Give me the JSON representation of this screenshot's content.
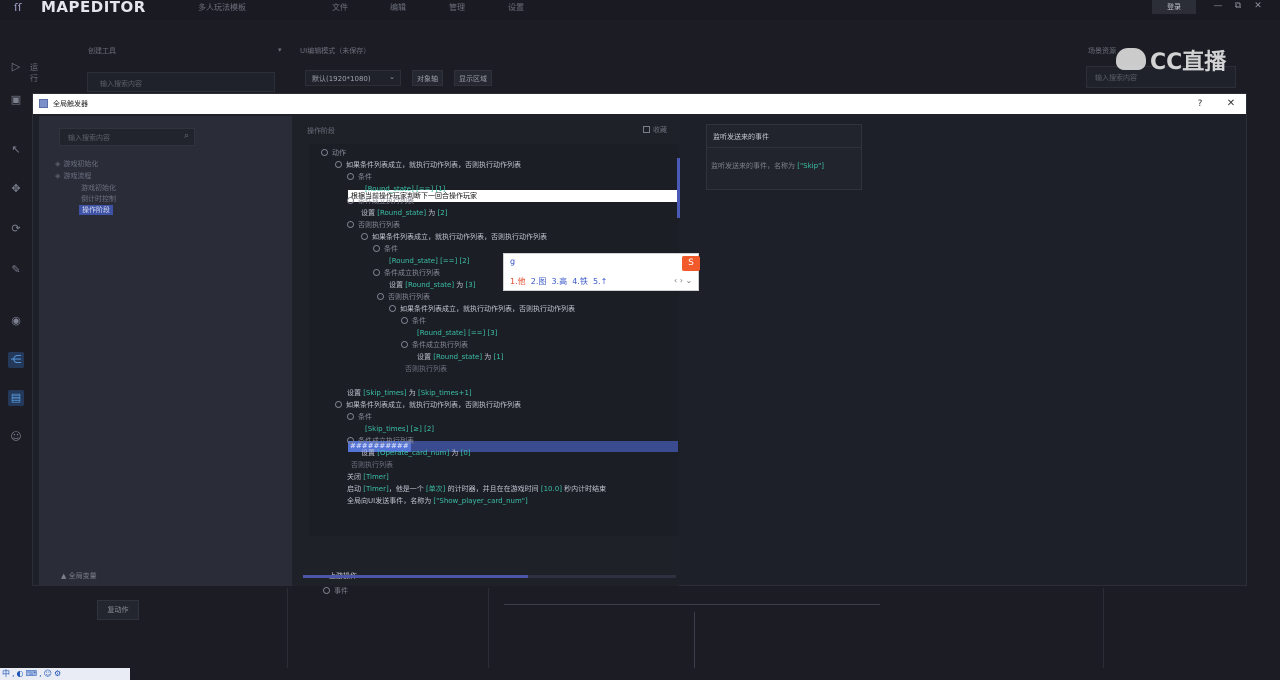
{
  "app": {
    "logo": "ſſ",
    "title": "MAPEDITOR",
    "subtitle": "多人玩法模板",
    "menu": [
      "文件",
      "编辑",
      "管理",
      "设置"
    ],
    "login_label": "登录",
    "win_controls": [
      "—",
      "⧉",
      "✕"
    ]
  },
  "left_tools": {
    "run_label": "运行",
    "icons": [
      "play-icon",
      "save-icon",
      "pointer-icon",
      "move-icon",
      "rotate-icon",
      "edit-icon",
      "layer-icon",
      "share-icon",
      "ui-icon",
      "robot-icon"
    ]
  },
  "background": {
    "create_tools_title": "创建工具",
    "create_search_placeholder": "输入搜索内容",
    "ui_mode_title": "UI编辑模式（未保存）",
    "resolution": "默认(1920*1080)",
    "btn_object_axis": "对象轴",
    "btn_show_area": "显示区域",
    "right_panel_title": "场景资源",
    "right_search_placeholder": "输入搜索内容",
    "watermark": "CC直播",
    "bottom_button": "复动作",
    "taskbar": "中,◐⌨,☺⚙"
  },
  "dialog": {
    "title": "全局触发器",
    "help": "?",
    "close": "✕",
    "left": {
      "search_placeholder": "输入搜索内容",
      "tree": [
        {
          "label": "游戏初始化",
          "selected": false
        },
        {
          "label": "游戏流程",
          "selected": false
        },
        {
          "label": "游戏初始化",
          "selected": false
        },
        {
          "label": "倒计时控制",
          "selected": false
        },
        {
          "label": "操作阶段",
          "selected": true
        }
      ],
      "global_vars": "全局变量"
    },
    "middle": {
      "title": "操作阶段",
      "collect_label": "收藏",
      "editing_line": "根据当前操作玩家判断下一回合操作玩家",
      "selected_text": "##########",
      "lines": [
        {
          "text": "动作",
          "kind": "node"
        },
        {
          "text": "如果条件列表成立，就执行动作列表，否则执行动作列表",
          "kind": "plain"
        },
        {
          "text": "条件",
          "kind": "node"
        },
        {
          "text": "[Round_state] [==] [1]",
          "kind": "token"
        },
        {
          "text": "条件成立执行列表",
          "kind": "node"
        },
        {
          "pre": "设置 ",
          "tk": "[Round_state]",
          "post": " 为 ",
          "tk2": "[2]",
          "kind": "mixed"
        },
        {
          "text": "否则执行列表",
          "kind": "node"
        },
        {
          "text": "如果条件列表成立，就执行动作列表，否则执行动作列表",
          "kind": "plain"
        },
        {
          "text": "条件",
          "kind": "node"
        },
        {
          "text": "[Round_state] [==] [2]",
          "kind": "token"
        },
        {
          "text": "条件成立执行列表",
          "kind": "node"
        },
        {
          "pre": "设置 ",
          "tk": "[Round_state]",
          "post": " 为 ",
          "tk2": "[3]",
          "kind": "mixed"
        },
        {
          "text": "否则执行列表",
          "kind": "node"
        },
        {
          "text": "如果条件列表成立，就执行动作列表，否则执行动作列表",
          "kind": "plain"
        },
        {
          "text": "条件",
          "kind": "node"
        },
        {
          "text": "[Round_state] [==] [3]",
          "kind": "token"
        },
        {
          "text": "条件成立执行列表",
          "kind": "node"
        },
        {
          "pre": "设置 ",
          "tk": "[Round_state]",
          "post": " 为 ",
          "tk2": "[1]",
          "kind": "mixed"
        },
        {
          "text": "否则执行列表",
          "kind": "dim"
        },
        {
          "pre": "设置 ",
          "tk": "[Skip_times]",
          "post": " 为 ",
          "tk2": "[Skip_times+1]",
          "kind": "mixed"
        },
        {
          "text": "如果条件列表成立，就执行动作列表，否则执行动作列表",
          "kind": "plain"
        },
        {
          "text": "条件",
          "kind": "node"
        },
        {
          "text": "[Skip_times] [≥] [2]",
          "kind": "token"
        },
        {
          "text": "条件成立执行列表",
          "kind": "node"
        },
        {
          "pre": "设置 ",
          "tk": "[Operate_card_num]",
          "post": " 为 ",
          "tk2": "[0]",
          "kind": "mixed"
        },
        {
          "text": "否则执行列表",
          "kind": "dim"
        },
        {
          "pre": "关闭 ",
          "tk": "[Timer]",
          "post": "",
          "tk2": "",
          "kind": "mixed"
        },
        {
          "pre": "启动 ",
          "tk": "[Timer]",
          "post": "，他是一个 ",
          "tk2": "[单次]",
          "post2": " 的计时器，并且在在游戏时间 ",
          "tk3": "[10.0]",
          "post3": " 秒内计时结束",
          "kind": "mixed3"
        },
        {
          "pre": "全局向UI发送事件，名称为 ",
          "tk": "[\"Show_player_card_num\"]",
          "post": "",
          "tk2": "",
          "kind": "mixed"
        }
      ],
      "upper_op_title": "上游操作",
      "upper_op_event": "事件"
    },
    "ime": {
      "input": "g",
      "logo": "S",
      "candidates": [
        "1.他",
        "2.图",
        "3.高",
        "4.铁",
        "5.↑"
      ],
      "pager": "‹ › ⌄"
    },
    "right": {
      "title": "监听发送来的事件",
      "desc_prefix": "监听发送来的事件，名称为 ",
      "desc_token": "[\"Skip\"]"
    }
  }
}
